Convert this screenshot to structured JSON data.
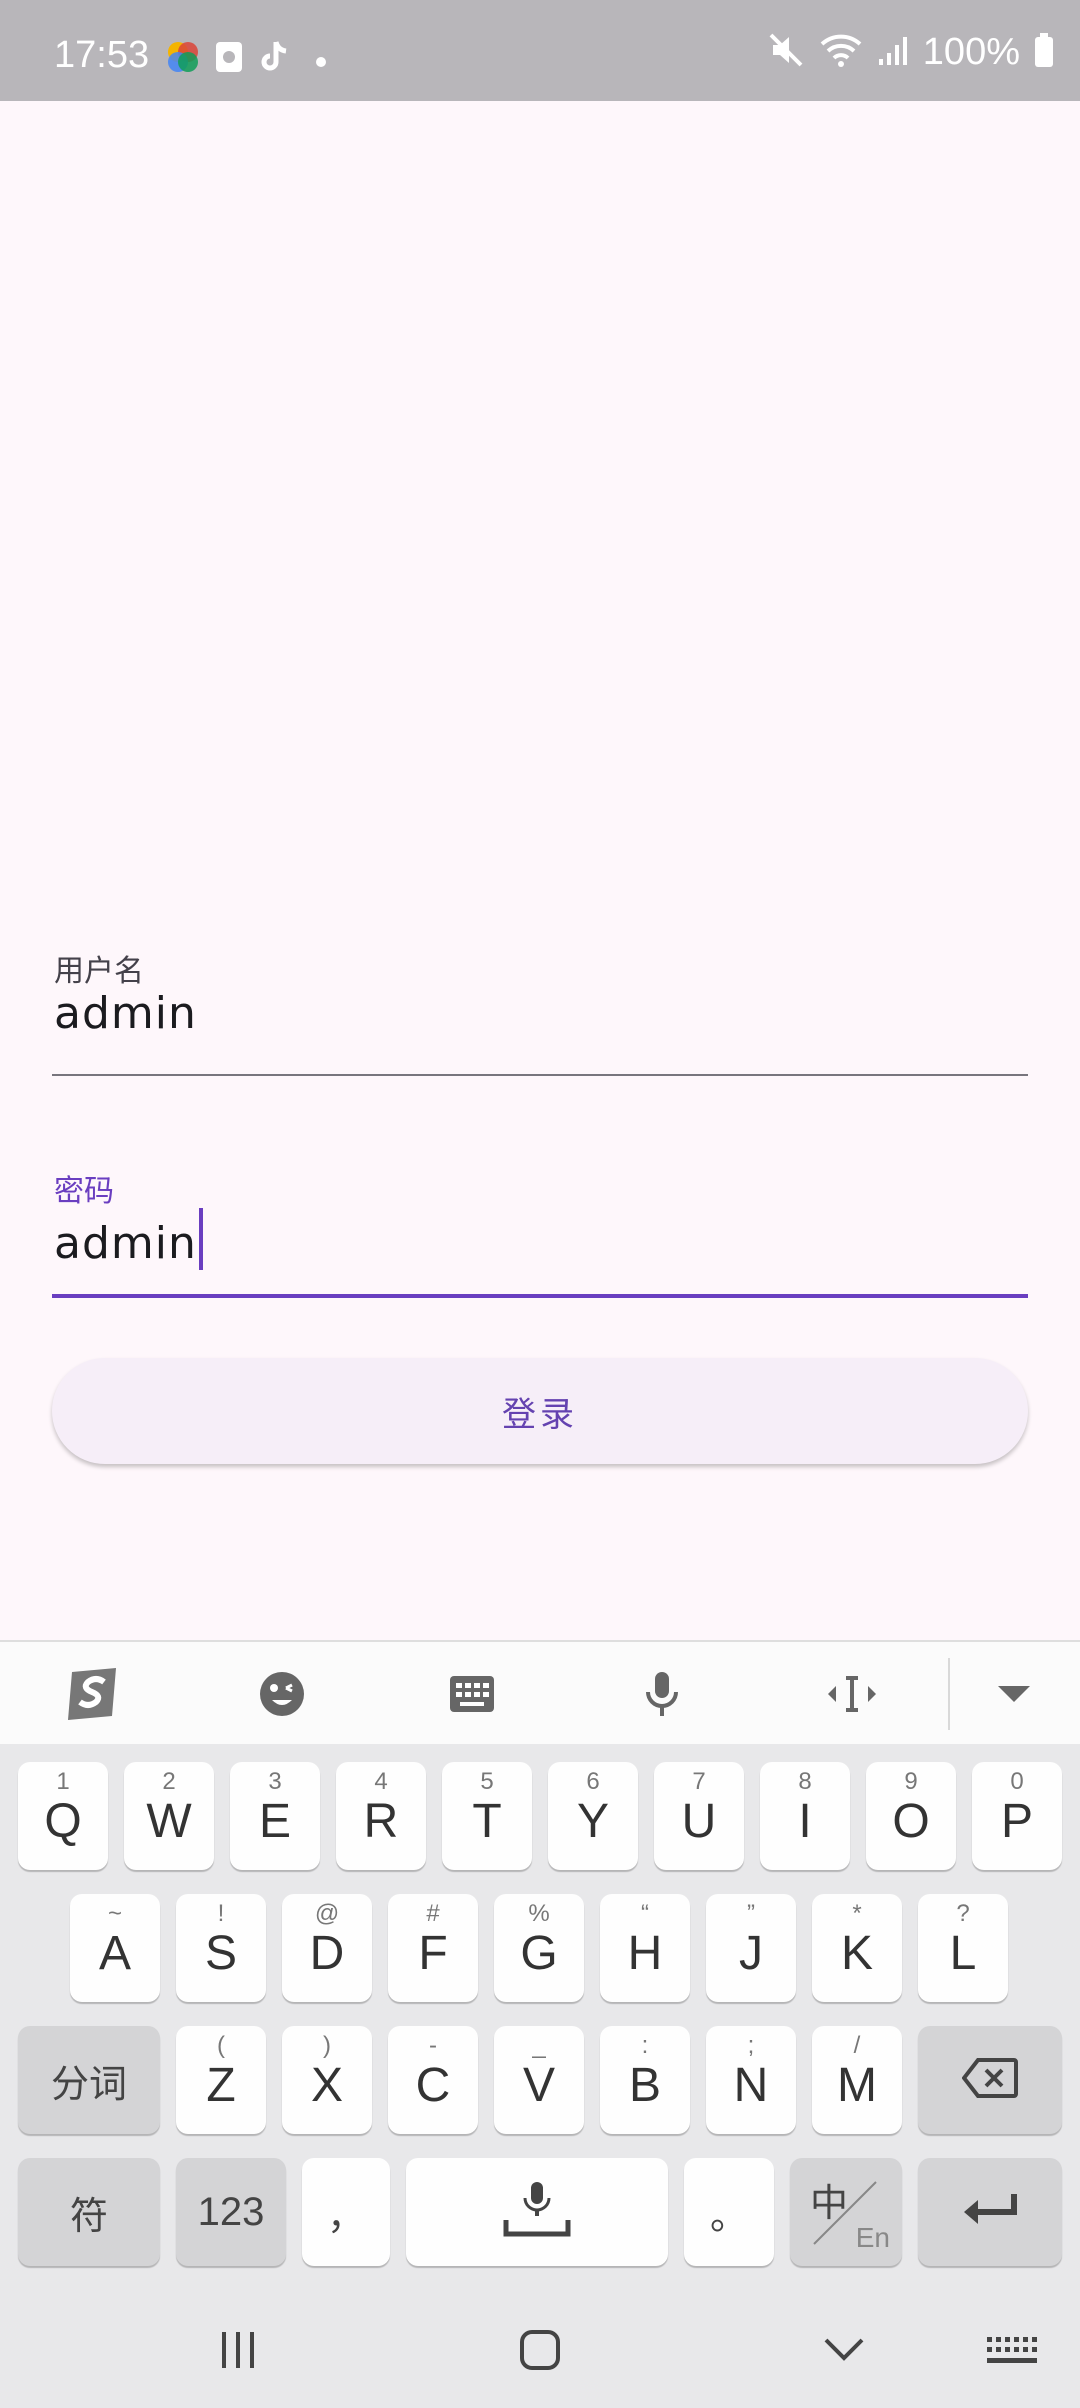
{
  "status_bar": {
    "time": "17:53",
    "battery_text": "100%",
    "icons": [
      "photos-icon",
      "sim-toolkit-icon",
      "tiktok-icon",
      "notification-dot-icon",
      "mute-icon",
      "wifi-icon",
      "signal-icon",
      "battery-icon"
    ]
  },
  "form": {
    "username": {
      "label": "用户名",
      "value": "admin"
    },
    "password": {
      "label": "密码",
      "value": "admin"
    },
    "login_label": "登录",
    "accent_color": "#6a3ec0"
  },
  "keyboard": {
    "toolbar": [
      "sogou-logo-icon",
      "emoji-icon",
      "keyboard-icon",
      "microphone-icon",
      "cursor-move-icon",
      "collapse-keyboard-icon"
    ],
    "row1": [
      {
        "k": "Q",
        "s": "1"
      },
      {
        "k": "W",
        "s": "2"
      },
      {
        "k": "E",
        "s": "3"
      },
      {
        "k": "R",
        "s": "4"
      },
      {
        "k": "T",
        "s": "5"
      },
      {
        "k": "Y",
        "s": "6"
      },
      {
        "k": "U",
        "s": "7"
      },
      {
        "k": "I",
        "s": "8"
      },
      {
        "k": "O",
        "s": "9"
      },
      {
        "k": "P",
        "s": "0"
      }
    ],
    "row2": [
      {
        "k": "A",
        "s": "~"
      },
      {
        "k": "S",
        "s": "!"
      },
      {
        "k": "D",
        "s": "@"
      },
      {
        "k": "F",
        "s": "#"
      },
      {
        "k": "G",
        "s": "%"
      },
      {
        "k": "H",
        "s": "“"
      },
      {
        "k": "J",
        "s": "”"
      },
      {
        "k": "K",
        "s": "*"
      },
      {
        "k": "L",
        "s": "?"
      }
    ],
    "row3": [
      {
        "k": "Z",
        "s": "("
      },
      {
        "k": "X",
        "s": ")"
      },
      {
        "k": "C",
        "s": "-"
      },
      {
        "k": "V",
        "s": "_"
      },
      {
        "k": "B",
        "s": ":"
      },
      {
        "k": "N",
        "s": ";"
      },
      {
        "k": "M",
        "s": "/"
      }
    ],
    "segment_label": "分词",
    "symbol_label": "符",
    "number_label": "123",
    "comma_label": "，",
    "period_label": "。",
    "lang_main": "中",
    "lang_sub": "En"
  },
  "nav_bar": [
    "recent-apps-icon",
    "home-icon",
    "back-icon",
    "keyboard-switch-icon"
  ]
}
